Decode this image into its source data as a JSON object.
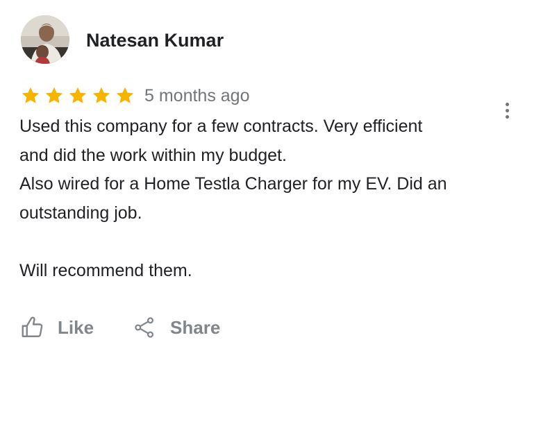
{
  "reviewer": {
    "name": "Natesan Kumar"
  },
  "review": {
    "rating": 5,
    "rating_max": 5,
    "date": "5 months ago",
    "lines": [
      "Used this company for a few contracts. Very efficient",
      "and did the work within my budget.",
      "Also wired for a Home Testla Charger for my EV. Did an",
      "outstanding job.",
      "",
      "Will recommend them."
    ]
  },
  "actions": {
    "like_label": "Like",
    "share_label": "Share"
  },
  "icons": {
    "star": "star-icon",
    "more": "more-vert-icon",
    "like": "thumb-up-outline-icon",
    "share": "share-icon"
  },
  "colors": {
    "star": "#F5B400",
    "name_text": "#202124",
    "body_text": "#202124",
    "muted_text": "#70757A",
    "action_text": "#80868B"
  }
}
